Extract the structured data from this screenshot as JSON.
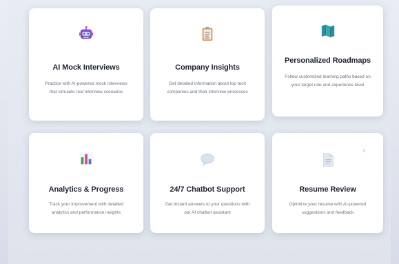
{
  "features": [
    {
      "title": "AI Mock Interviews",
      "description": "Practice with AI-powered mock interviews that simulate real interview scenarios",
      "icon": "robot-icon"
    },
    {
      "title": "Company Insights",
      "description": "Get detailed information about top tech companies and their interview processes",
      "icon": "clipboard-icon"
    },
    {
      "title": "Personalized Roadmaps",
      "description": "Follow customized learning paths based on your target role and experience level",
      "icon": "map-icon"
    },
    {
      "title": "Analytics & Progress",
      "description": "Track your improvement with detailed analytics and performance insights",
      "icon": "bar-chart-icon"
    },
    {
      "title": "24/7 Chatbot Support",
      "description": "Get instant answers to your questions with our AI chatbot assistant",
      "icon": "speech-bubble-icon"
    },
    {
      "title": "Resume Review",
      "description": "Optimize your resume with AI-powered suggestions and feedback",
      "icon": "document-icon"
    }
  ],
  "colors": {
    "title": "#1f2433",
    "description": "#6a7080",
    "card_background": "#ffffff",
    "page_background": "#e4e8f0"
  }
}
